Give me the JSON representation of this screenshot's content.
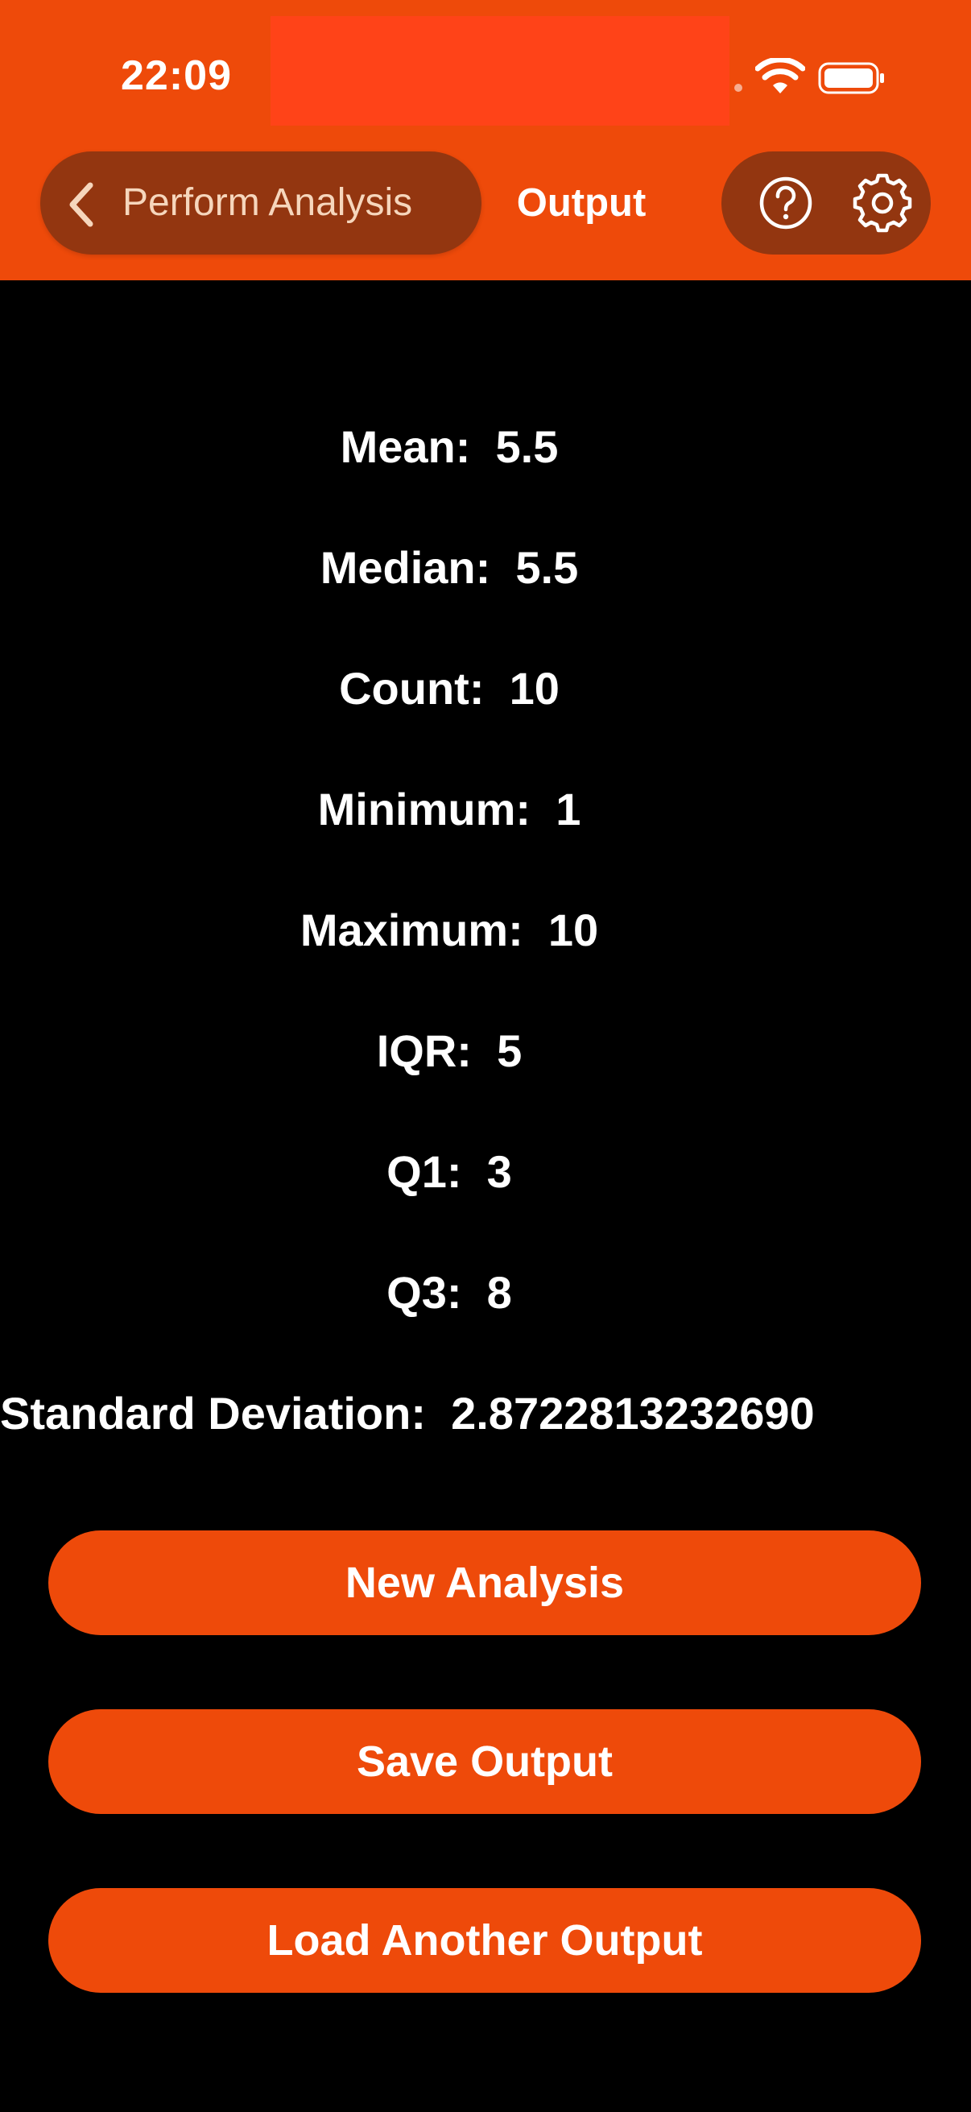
{
  "status_bar": {
    "time": "22:09"
  },
  "nav": {
    "back_label": "Perform Analysis",
    "title": "Output",
    "icons": [
      "chevron-left-icon",
      "question-circle-icon",
      "gear-icon"
    ]
  },
  "stats": [
    {
      "label": "Mean:",
      "value": "5.5"
    },
    {
      "label": "Median:",
      "value": "5.5"
    },
    {
      "label": "Count:",
      "value": "10"
    },
    {
      "label": "Minimum:",
      "value": "1"
    },
    {
      "label": "Maximum:",
      "value": "10"
    },
    {
      "label": "IQR:",
      "value": "5"
    },
    {
      "label": "Q1:",
      "value": "3"
    },
    {
      "label": "Q3:",
      "value": "8"
    },
    {
      "label": "Standard Deviation:",
      "value": "2.8722813232690"
    }
  ],
  "buttons": {
    "new_analysis": "New Analysis",
    "save_output": "Save Output",
    "load_another": "Load Another Output"
  },
  "colors": {
    "accent": "#EE4A0A",
    "pill": "#933610",
    "background": "#000000",
    "redaction": "#FF4318"
  }
}
